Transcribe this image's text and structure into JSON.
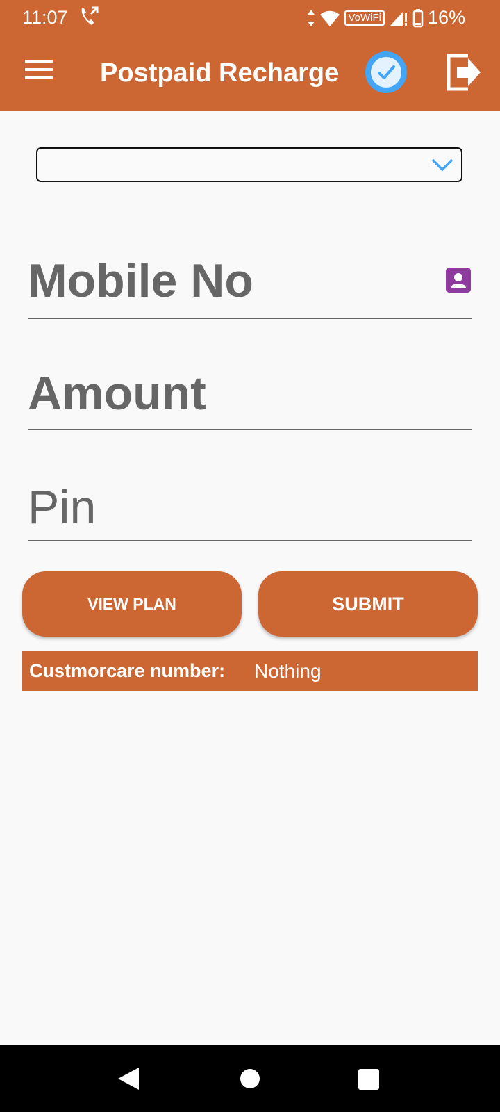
{
  "status_bar": {
    "time": "11:07",
    "vowifi": "VoWiFi",
    "battery": "16%"
  },
  "toolbar": {
    "title": "Postpaid Recharge"
  },
  "form": {
    "operator_value": "",
    "mobile_label": "Mobile No",
    "amount_label": "Amount",
    "pin_label": "Pin"
  },
  "buttons": {
    "view_plan": "VIEW PLAN",
    "submit": "SUBMIT"
  },
  "customer_care": {
    "label": "Custmorcare number:",
    "value": "Nothing"
  },
  "colors": {
    "primary": "#cc6633",
    "background": "#f9f9f9",
    "accent_blue": "#42a5f5",
    "contact_purple": "#8e3a9e"
  }
}
